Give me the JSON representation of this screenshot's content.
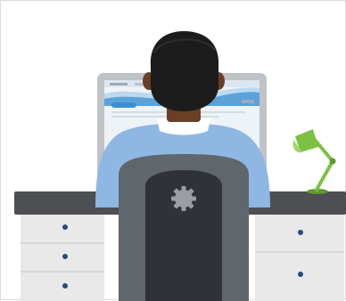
{
  "illustration": {
    "colors": {
      "background": "#ffffff",
      "frame_border": "#dcdcdc",
      "desk_top": "#4e4f52",
      "desk_drawers": "#e9e9e9",
      "drawer_knob": "#2a4a7c",
      "monitor_bezel": "#bfc2c6",
      "monitor_screen": "#eef3f8",
      "screen_banner": "#3a8fd0",
      "shirt": "#8fb7e3",
      "collar": "#ffffff",
      "skin": "#6a3f25",
      "hair": "#1c1c1c",
      "chair_back": "#5f666c",
      "chair_inner": "#2f3337",
      "chair_gear": "#9a9da1",
      "lamp": "#7cc143"
    },
    "icons": {
      "chair_emblem": "gear-icon",
      "lamp": "desk-lamp-icon"
    }
  }
}
